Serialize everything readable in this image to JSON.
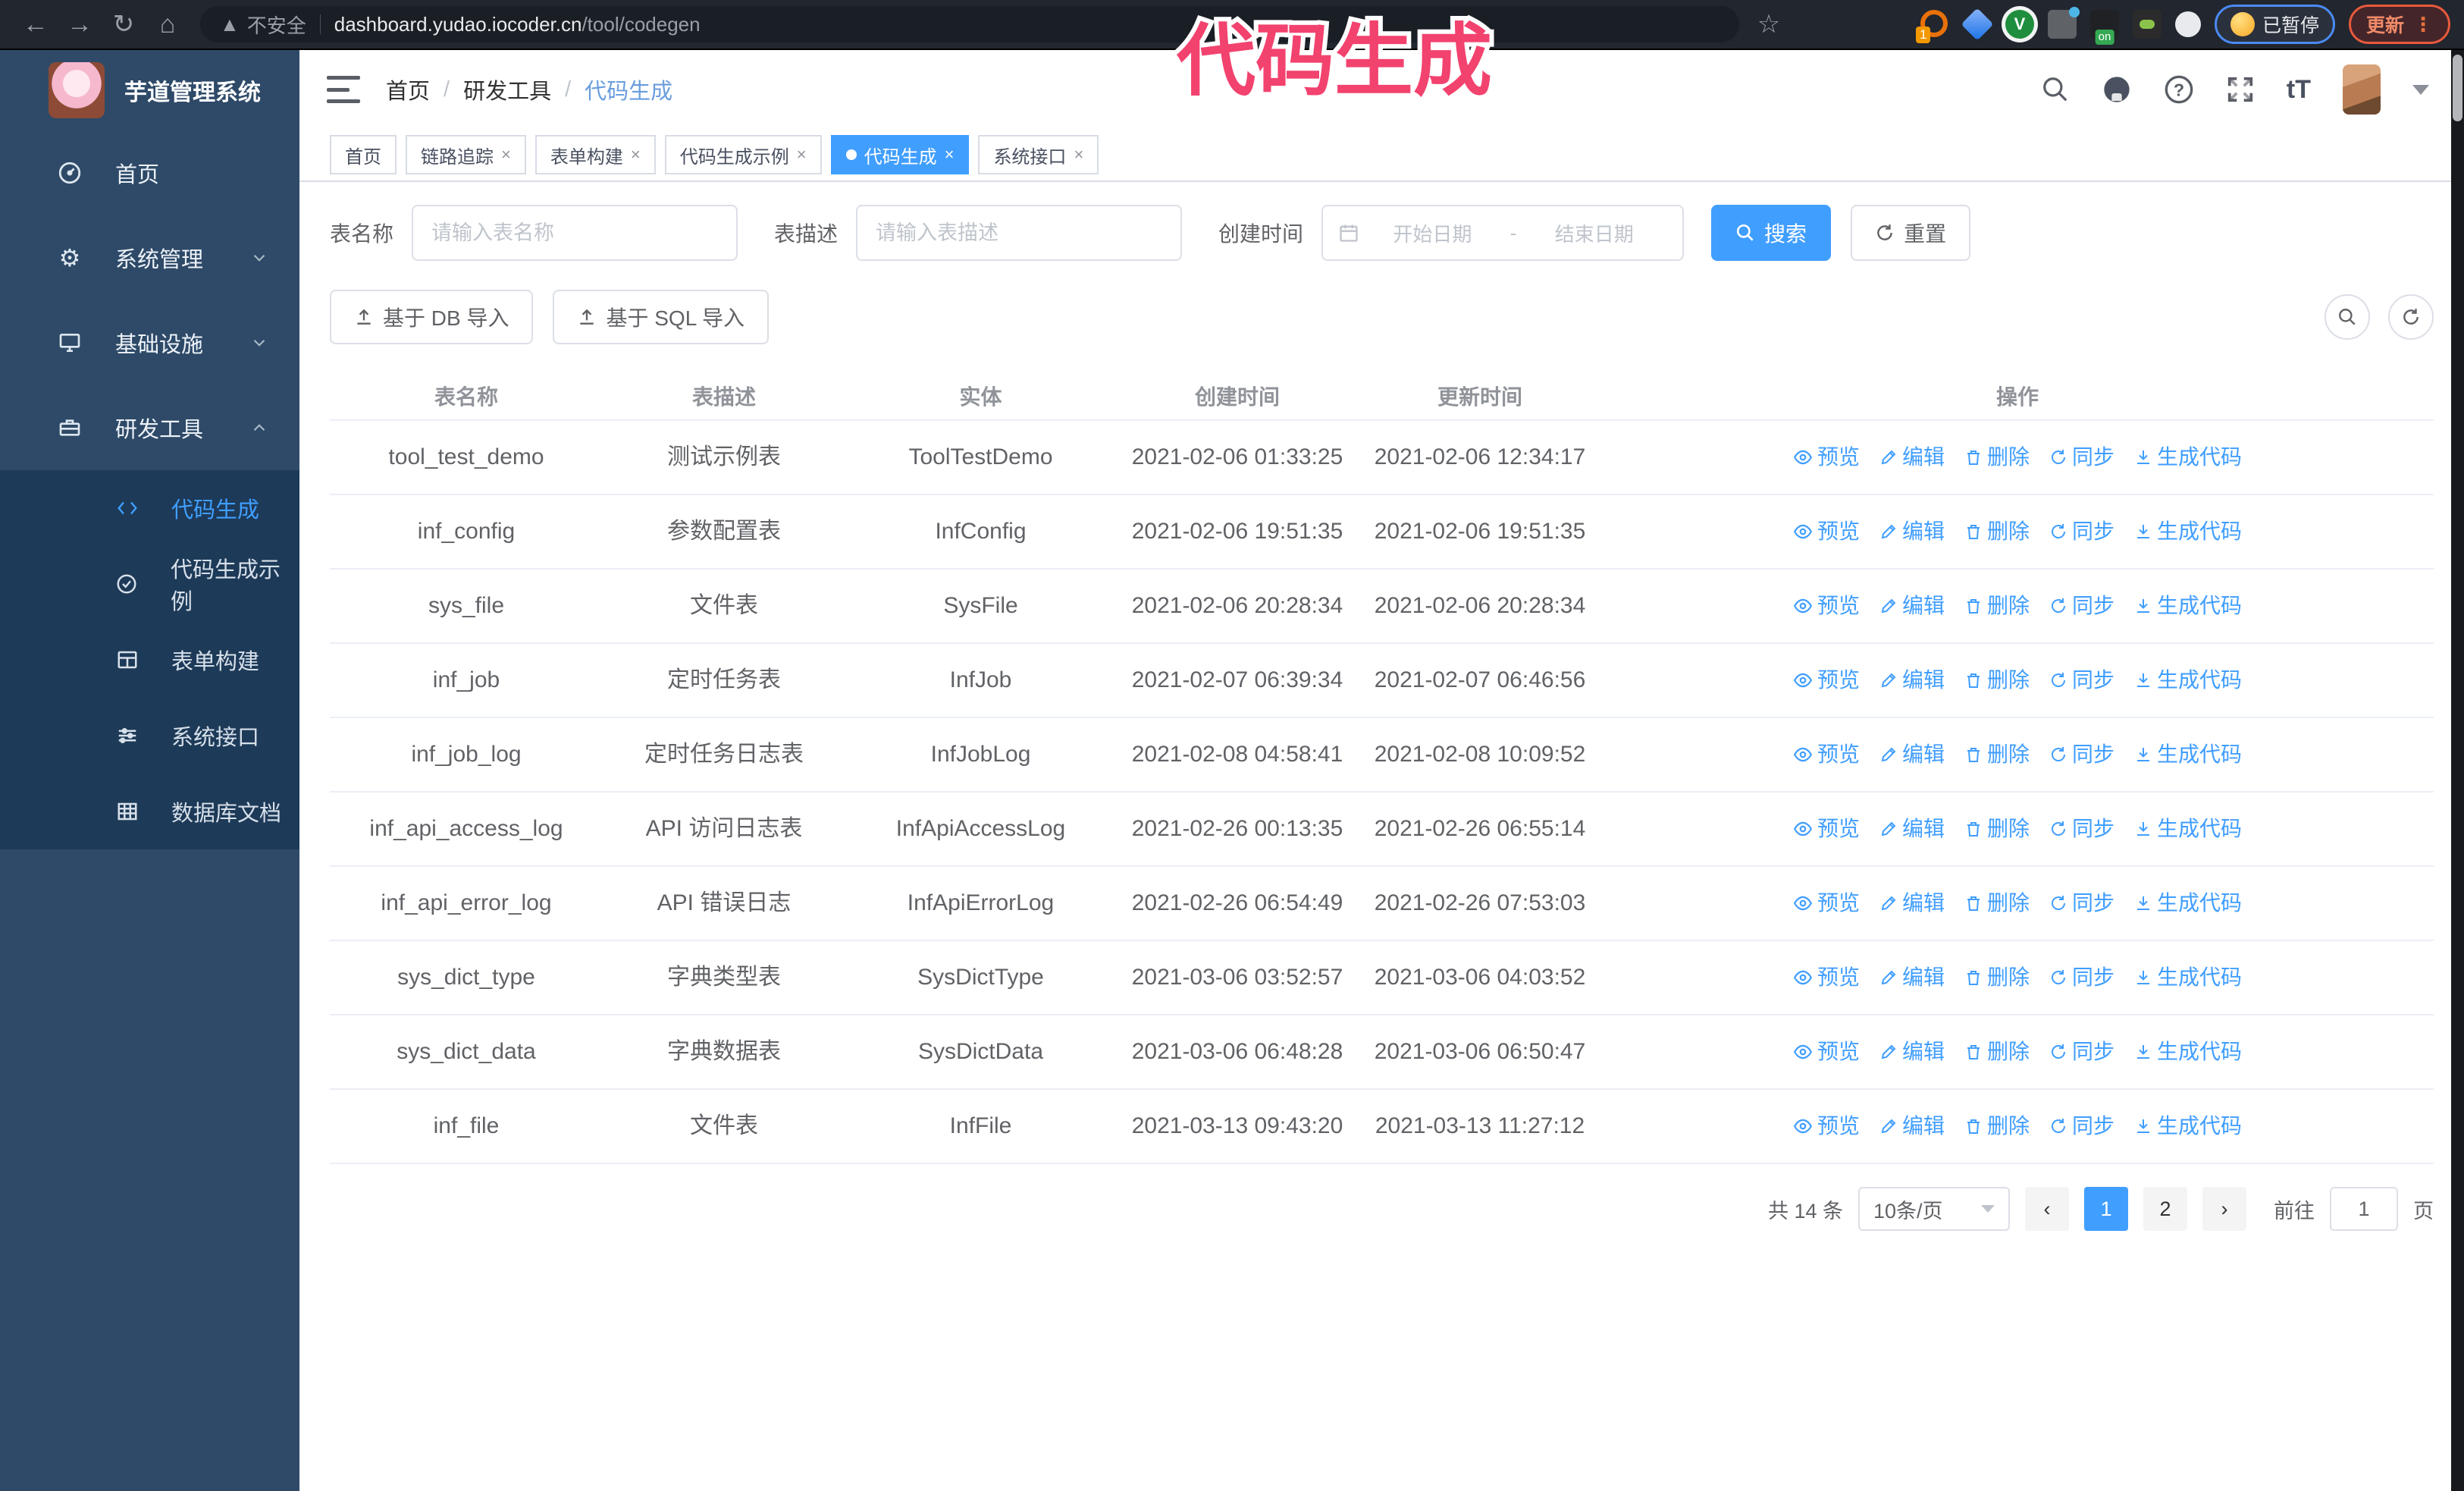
{
  "browser": {
    "security_label": "不安全",
    "url_host": "dashboard.yudao.iocoder.cn",
    "url_path": "/tool/codegen",
    "extension_badge": "1",
    "extension_on_badge": "on",
    "profile_label": "已暂停",
    "update_label": "更新"
  },
  "annotation": {
    "text": "代码生成",
    "color": "#f2426e"
  },
  "sidebar": {
    "title": "芋道管理系统",
    "items": [
      {
        "label": "首页"
      },
      {
        "label": "系统管理"
      },
      {
        "label": "基础设施"
      },
      {
        "label": "研发工具"
      }
    ],
    "subitems": [
      {
        "label": "代码生成",
        "active": true
      },
      {
        "label": "代码生成示例"
      },
      {
        "label": "表单构建"
      },
      {
        "label": "系统接口"
      },
      {
        "label": "数据库文档"
      }
    ]
  },
  "header": {
    "breadcrumb": [
      "首页",
      "研发工具",
      "代码生成"
    ]
  },
  "tags": [
    {
      "label": "首页"
    },
    {
      "label": "链路追踪"
    },
    {
      "label": "表单构建"
    },
    {
      "label": "代码生成示例"
    },
    {
      "label": "代码生成",
      "active": true
    },
    {
      "label": "系统接口"
    }
  ],
  "search": {
    "name_label": "表名称",
    "name_placeholder": "请输入表名称",
    "desc_label": "表描述",
    "desc_placeholder": "请输入表描述",
    "time_label": "创建时间",
    "start_placeholder": "开始日期",
    "range_separator": "-",
    "end_placeholder": "结束日期",
    "search_label": "搜索",
    "reset_label": "重置"
  },
  "toolbar": {
    "db_import_label": "基于 DB 导入",
    "sql_import_label": "基于 SQL 导入"
  },
  "table": {
    "columns": [
      "表名称",
      "表描述",
      "实体",
      "创建时间",
      "更新时间",
      "操作"
    ],
    "actions": [
      "预览",
      "编辑",
      "删除",
      "同步",
      "生成代码"
    ],
    "rows": [
      {
        "name": "tool_test_demo",
        "desc": "测试示例表",
        "entity": "ToolTestDemo",
        "created": "2021-02-06 01:33:25",
        "updated": "2021-02-06 12:34:17"
      },
      {
        "name": "inf_config",
        "desc": "参数配置表",
        "entity": "InfConfig",
        "created": "2021-02-06 19:51:35",
        "updated": "2021-02-06 19:51:35"
      },
      {
        "name": "sys_file",
        "desc": "文件表",
        "entity": "SysFile",
        "created": "2021-02-06 20:28:34",
        "updated": "2021-02-06 20:28:34"
      },
      {
        "name": "inf_job",
        "desc": "定时任务表",
        "entity": "InfJob",
        "created": "2021-02-07 06:39:34",
        "updated": "2021-02-07 06:46:56"
      },
      {
        "name": "inf_job_log",
        "desc": "定时任务日志表",
        "entity": "InfJobLog",
        "created": "2021-02-08 04:58:41",
        "updated": "2021-02-08 10:09:52"
      },
      {
        "name": "inf_api_access_log",
        "desc": "API 访问日志表",
        "entity": "InfApiAccessLog",
        "created": "2021-02-26 00:13:35",
        "updated": "2021-02-26 06:55:14"
      },
      {
        "name": "inf_api_error_log",
        "desc": "API 错误日志",
        "entity": "InfApiErrorLog",
        "created": "2021-02-26 06:54:49",
        "updated": "2021-02-26 07:53:03"
      },
      {
        "name": "sys_dict_type",
        "desc": "字典类型表",
        "entity": "SysDictType",
        "created": "2021-03-06 03:52:57",
        "updated": "2021-03-06 04:03:52"
      },
      {
        "name": "sys_dict_data",
        "desc": "字典数据表",
        "entity": "SysDictData",
        "created": "2021-03-06 06:48:28",
        "updated": "2021-03-06 06:50:47"
      },
      {
        "name": "inf_file",
        "desc": "文件表",
        "entity": "InfFile",
        "created": "2021-03-13 09:43:20",
        "updated": "2021-03-13 11:27:12"
      }
    ]
  },
  "pagination": {
    "total_label": "共 14 条",
    "page_size": "10条/页",
    "pages": [
      "1",
      "2"
    ],
    "active_page": "1",
    "goto_label": "前往",
    "goto_value": "1",
    "page_unit": "页"
  },
  "colors": {
    "primary": "#409eff",
    "sidebar_bg": "#2e4a68",
    "submenu_bg": "#1d3a58",
    "annotation_pink": "#f2426e"
  }
}
